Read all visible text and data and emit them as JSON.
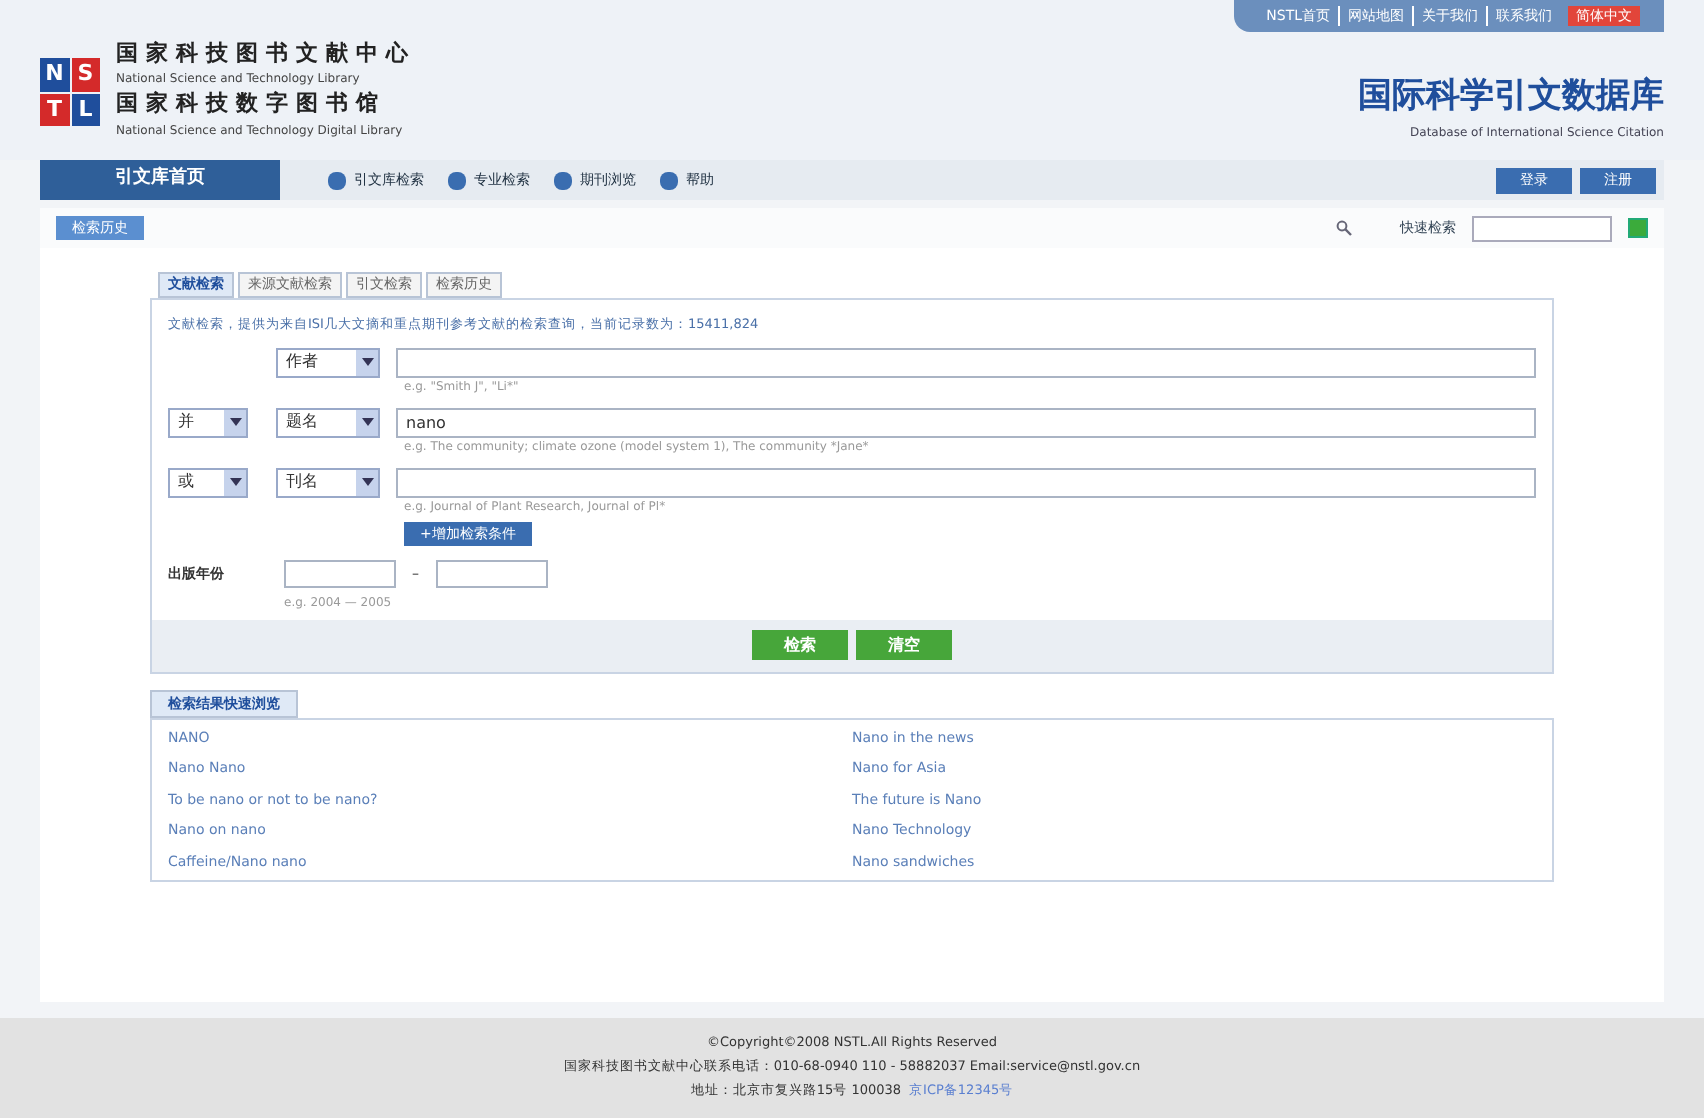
{
  "header": {
    "top_links": [
      "NSTL首页",
      "网站地图",
      "关于我们",
      "联系我们"
    ],
    "language": "简体中文",
    "org_lines": [
      {
        "kind": "cn",
        "text": "国家科技图书文献中心"
      },
      {
        "kind": "en",
        "text": "National Science and Technology Library"
      },
      {
        "kind": "cn",
        "text": "国家科技数字图书馆"
      },
      {
        "kind": "en",
        "text": "National Science and Technology Digital Library"
      }
    ],
    "logo_letters": [
      "N",
      "S",
      "T",
      "L"
    ],
    "db_title": "国际科学引文数据库",
    "db_subtitle": "Database of International Science Citation"
  },
  "nav": {
    "home": "引文库首页",
    "items": [
      "引文库检索",
      "专业检索",
      "期刊浏览",
      "帮助"
    ],
    "account_buttons": [
      "登录",
      "注册"
    ]
  },
  "toolbar": {
    "history_button": "检索历史",
    "quick_search_label": "快速检索"
  },
  "tabs": [
    {
      "label": "文献检索",
      "selected": true
    },
    {
      "label": "来源文献检索",
      "selected": false
    },
    {
      "label": "引文检索",
      "selected": false
    },
    {
      "label": "检索历史",
      "selected": false
    }
  ],
  "intro": "文献检索，提供为来自ISI几大文摘和重点期刊参考文献的检索查询，当前记录数为：15411,824",
  "rows": [
    {
      "field": "作者",
      "value": "",
      "hint": "e.g. \"Smith J\", \"Li*\""
    },
    {
      "operator": "并",
      "field": "题名",
      "value": "nano",
      "hint": "e.g. The community; climate ozone (model system 1), The community *Jane*"
    },
    {
      "operator": "或",
      "field": "刊名",
      "value": "",
      "hint": "e.g. Journal of Plant Research, Journal of Pl*"
    }
  ],
  "add_condition": "+增加检索条件",
  "year": {
    "label": "出版年份",
    "separator": "–",
    "hint": "e.g. 2004 — 2005"
  },
  "actions": [
    "检索",
    "清空"
  ],
  "quick_browse": {
    "title": "检索结果快速浏览",
    "links": [
      "NANO",
      "Nano in the news",
      "Nano Nano",
      "Nano for Asia",
      "To be nano or not to be nano?",
      "The future is Nano",
      "Nano on nano",
      "Nano Technology",
      "Caffeine/Nano nano",
      "Nano sandwiches"
    ]
  },
  "footer": {
    "copyright": "©Copyright©2008 NSTL.All Rights Reserved",
    "contact": "国家科技图书文献中心联系电话：010-68-0940 110 - 58882037 Email:service@nstl.gov.cn",
    "address": "地址：北京市复兴路15号 100038",
    "icp": "京ICP备12345号"
  }
}
